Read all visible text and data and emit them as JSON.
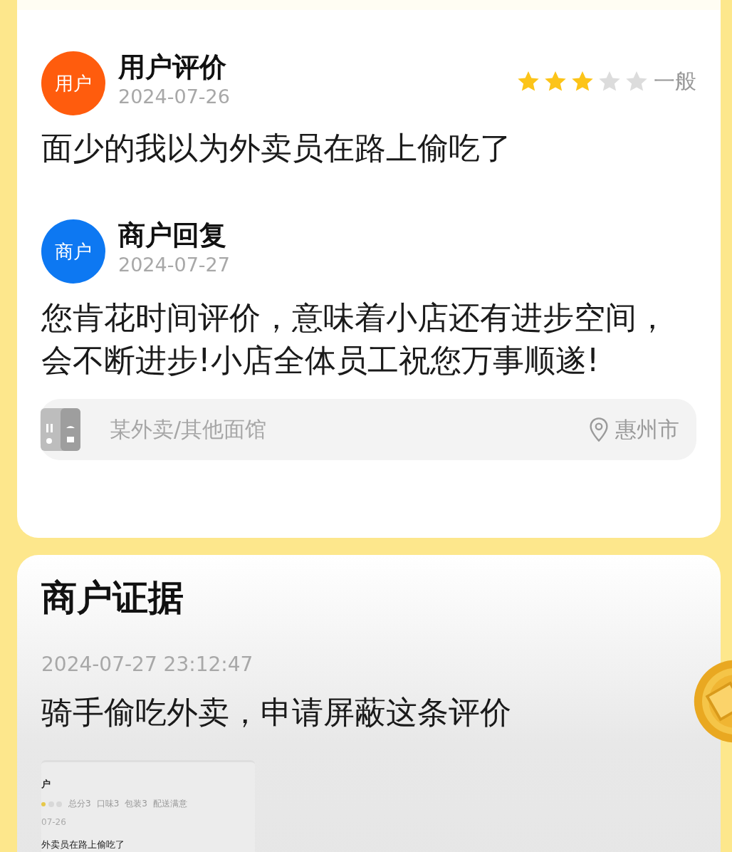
{
  "reviews": [
    {
      "kind": "user",
      "avatar": "用户",
      "color": "#ff5c0d",
      "title": "用户评价",
      "date": "2024-07-26",
      "stars": 3,
      "rating_label": "一般",
      "text": "面少的我以为外卖员在路上偷吃了"
    },
    {
      "kind": "merchant",
      "avatar": "商户",
      "color": "#0d78f2",
      "title": "商户回复",
      "date": "2024-07-27",
      "text": "您肯花时间评价，意味着小店还有进步空间，会不断进步!小店全体员工祝您万事顺遂!"
    }
  ],
  "shop": {
    "name": "某外卖/其他面馆",
    "location": "惠州市"
  },
  "evidence": {
    "title": "商户证据",
    "time": "2024-07-27 23:12:47",
    "text": "骑手偷吃外卖，申请屏蔽这条评价",
    "screenshot": {
      "name": "户",
      "scores": [
        "总分3",
        "口味3",
        "包装3",
        "配送满意"
      ],
      "date": "07-26",
      "text": "外卖员在路上偷吃了"
    }
  }
}
